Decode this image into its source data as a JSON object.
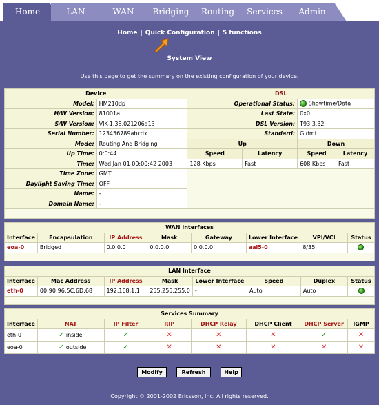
{
  "tabs": [
    {
      "label": "Home"
    },
    {
      "label": "LAN"
    },
    {
      "label": "WAN"
    },
    {
      "label": "Bridging"
    },
    {
      "label": "Routing"
    },
    {
      "label": "Services"
    },
    {
      "label": "Admin"
    }
  ],
  "nav": {
    "home": "Home",
    "sep": "|",
    "quick": "Quick Configuration",
    "functions": "5 functions"
  },
  "page": {
    "title": "System View",
    "intro": "Use this page to get the summary on the existing configuration of your device."
  },
  "device": {
    "header": "Device",
    "rows": [
      {
        "label": "Model:",
        "value": "HM210dp"
      },
      {
        "label": "H/W Version:",
        "value": "81001a"
      },
      {
        "label": "S/W Version:",
        "value": "VIK-1.38.021206a13"
      },
      {
        "label": "Serial Number:",
        "value": "123456789abcdx"
      },
      {
        "label": "Mode:",
        "value": "Routing And Bridging"
      },
      {
        "label": "Up Time:",
        "value": "0:0:44"
      },
      {
        "label": "Time:",
        "value": "Wed Jan 01 00:00:42 2003"
      },
      {
        "label": "Time Zone:",
        "value": "GMT"
      },
      {
        "label": "Daylight Saving Time:",
        "value": "OFF"
      },
      {
        "label": "Name:",
        "value": "-"
      },
      {
        "label": "Domain Name:",
        "value": "-"
      }
    ]
  },
  "dsl": {
    "header": "DSL",
    "operational_status_label": "Operational Status:",
    "operational_status": "Showtime/Data",
    "last_state_label": "Last State:",
    "last_state": "0x0",
    "dsl_version_label": "DSL Version:",
    "dsl_version": "T93.3.32",
    "standard_label": "Standard:",
    "standard": "G.dmt",
    "up_label": "Up",
    "down_label": "Down",
    "speed_label": "Speed",
    "latency_label": "Latency",
    "up_speed": "128 Kbps",
    "up_latency": "Fast",
    "down_speed": "608 Kbps",
    "down_latency": "Fast"
  },
  "wan": {
    "title": "WAN Interfaces",
    "headers": [
      "Interface",
      "Encapsulation",
      "IP Address",
      "Mask",
      "Gateway",
      "Lower Interface",
      "VPI/VCI",
      "Status"
    ],
    "row": {
      "interface": "eoa-0",
      "encapsulation": "Bridged",
      "ip": "0.0.0.0",
      "mask": "0.0.0.0",
      "gateway": "0.0.0.0",
      "lower": "aal5-0",
      "vpivci": "8/35"
    }
  },
  "lan": {
    "title": "LAN Interface",
    "headers": [
      "Interface",
      "Mac Address",
      "IP Address",
      "Mask",
      "Lower Interface",
      "Speed",
      "Duplex",
      "Status"
    ],
    "row": {
      "interface": "eth-0",
      "mac": "00:90:96:5C:6D:68",
      "ip": "192.168.1.1",
      "mask": "255.255.255.0",
      "lower": "-",
      "speed": "Auto",
      "duplex": "Auto"
    }
  },
  "services": {
    "title": "Services Summary",
    "headers": [
      "Interface",
      "NAT",
      "IP Filter",
      "RIP",
      "DHCP Relay",
      "DHCP Client",
      "DHCP Server",
      "IGMP"
    ],
    "rows": [
      {
        "interface": "eth-0",
        "nat": "inside"
      },
      {
        "interface": "eoa-0",
        "nat": "outside"
      }
    ]
  },
  "buttons": {
    "modify": "Modify",
    "refresh": "Refresh",
    "help": "Help"
  },
  "footer": {
    "copyright": "Copyright © 2001-2002 Ericsson, Inc. All rights reserved."
  },
  "colors": {
    "background": "#5b5b95",
    "tab": "#8c8cc0",
    "accent_red": "#a51515",
    "status_green": "#2f9a17"
  }
}
